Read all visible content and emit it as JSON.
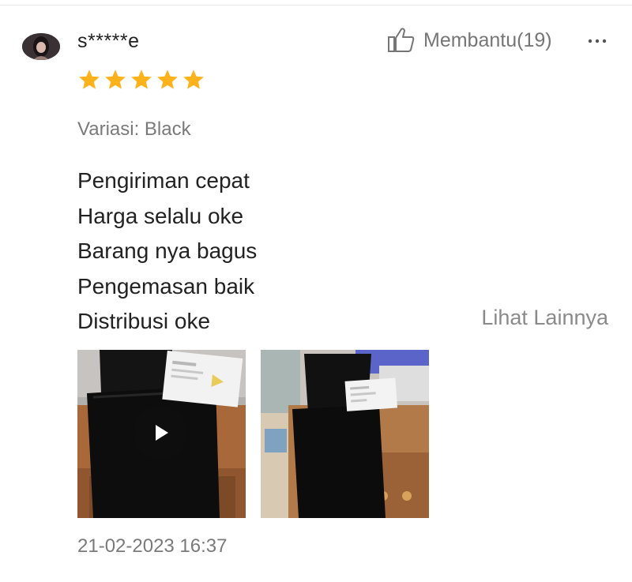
{
  "review": {
    "username": "s*****e",
    "avatar_icon": "user-avatar",
    "helpful_label": "Membantu(19)",
    "more_icon": "more-horizontal-icon",
    "rating": 5,
    "star_color": "#FFB21C",
    "variation": "Variasi: Black",
    "lines": [
      "Pengiriman cepat",
      "Harga selalu oke",
      "Barang nya bagus",
      "Pengemasan baik",
      "Distribusi oke"
    ],
    "see_more_label": "Lihat Lainnya",
    "media": [
      {
        "type": "video",
        "icon": "play-icon"
      },
      {
        "type": "photo"
      }
    ],
    "timestamp": "21-02-2023 16:37"
  }
}
